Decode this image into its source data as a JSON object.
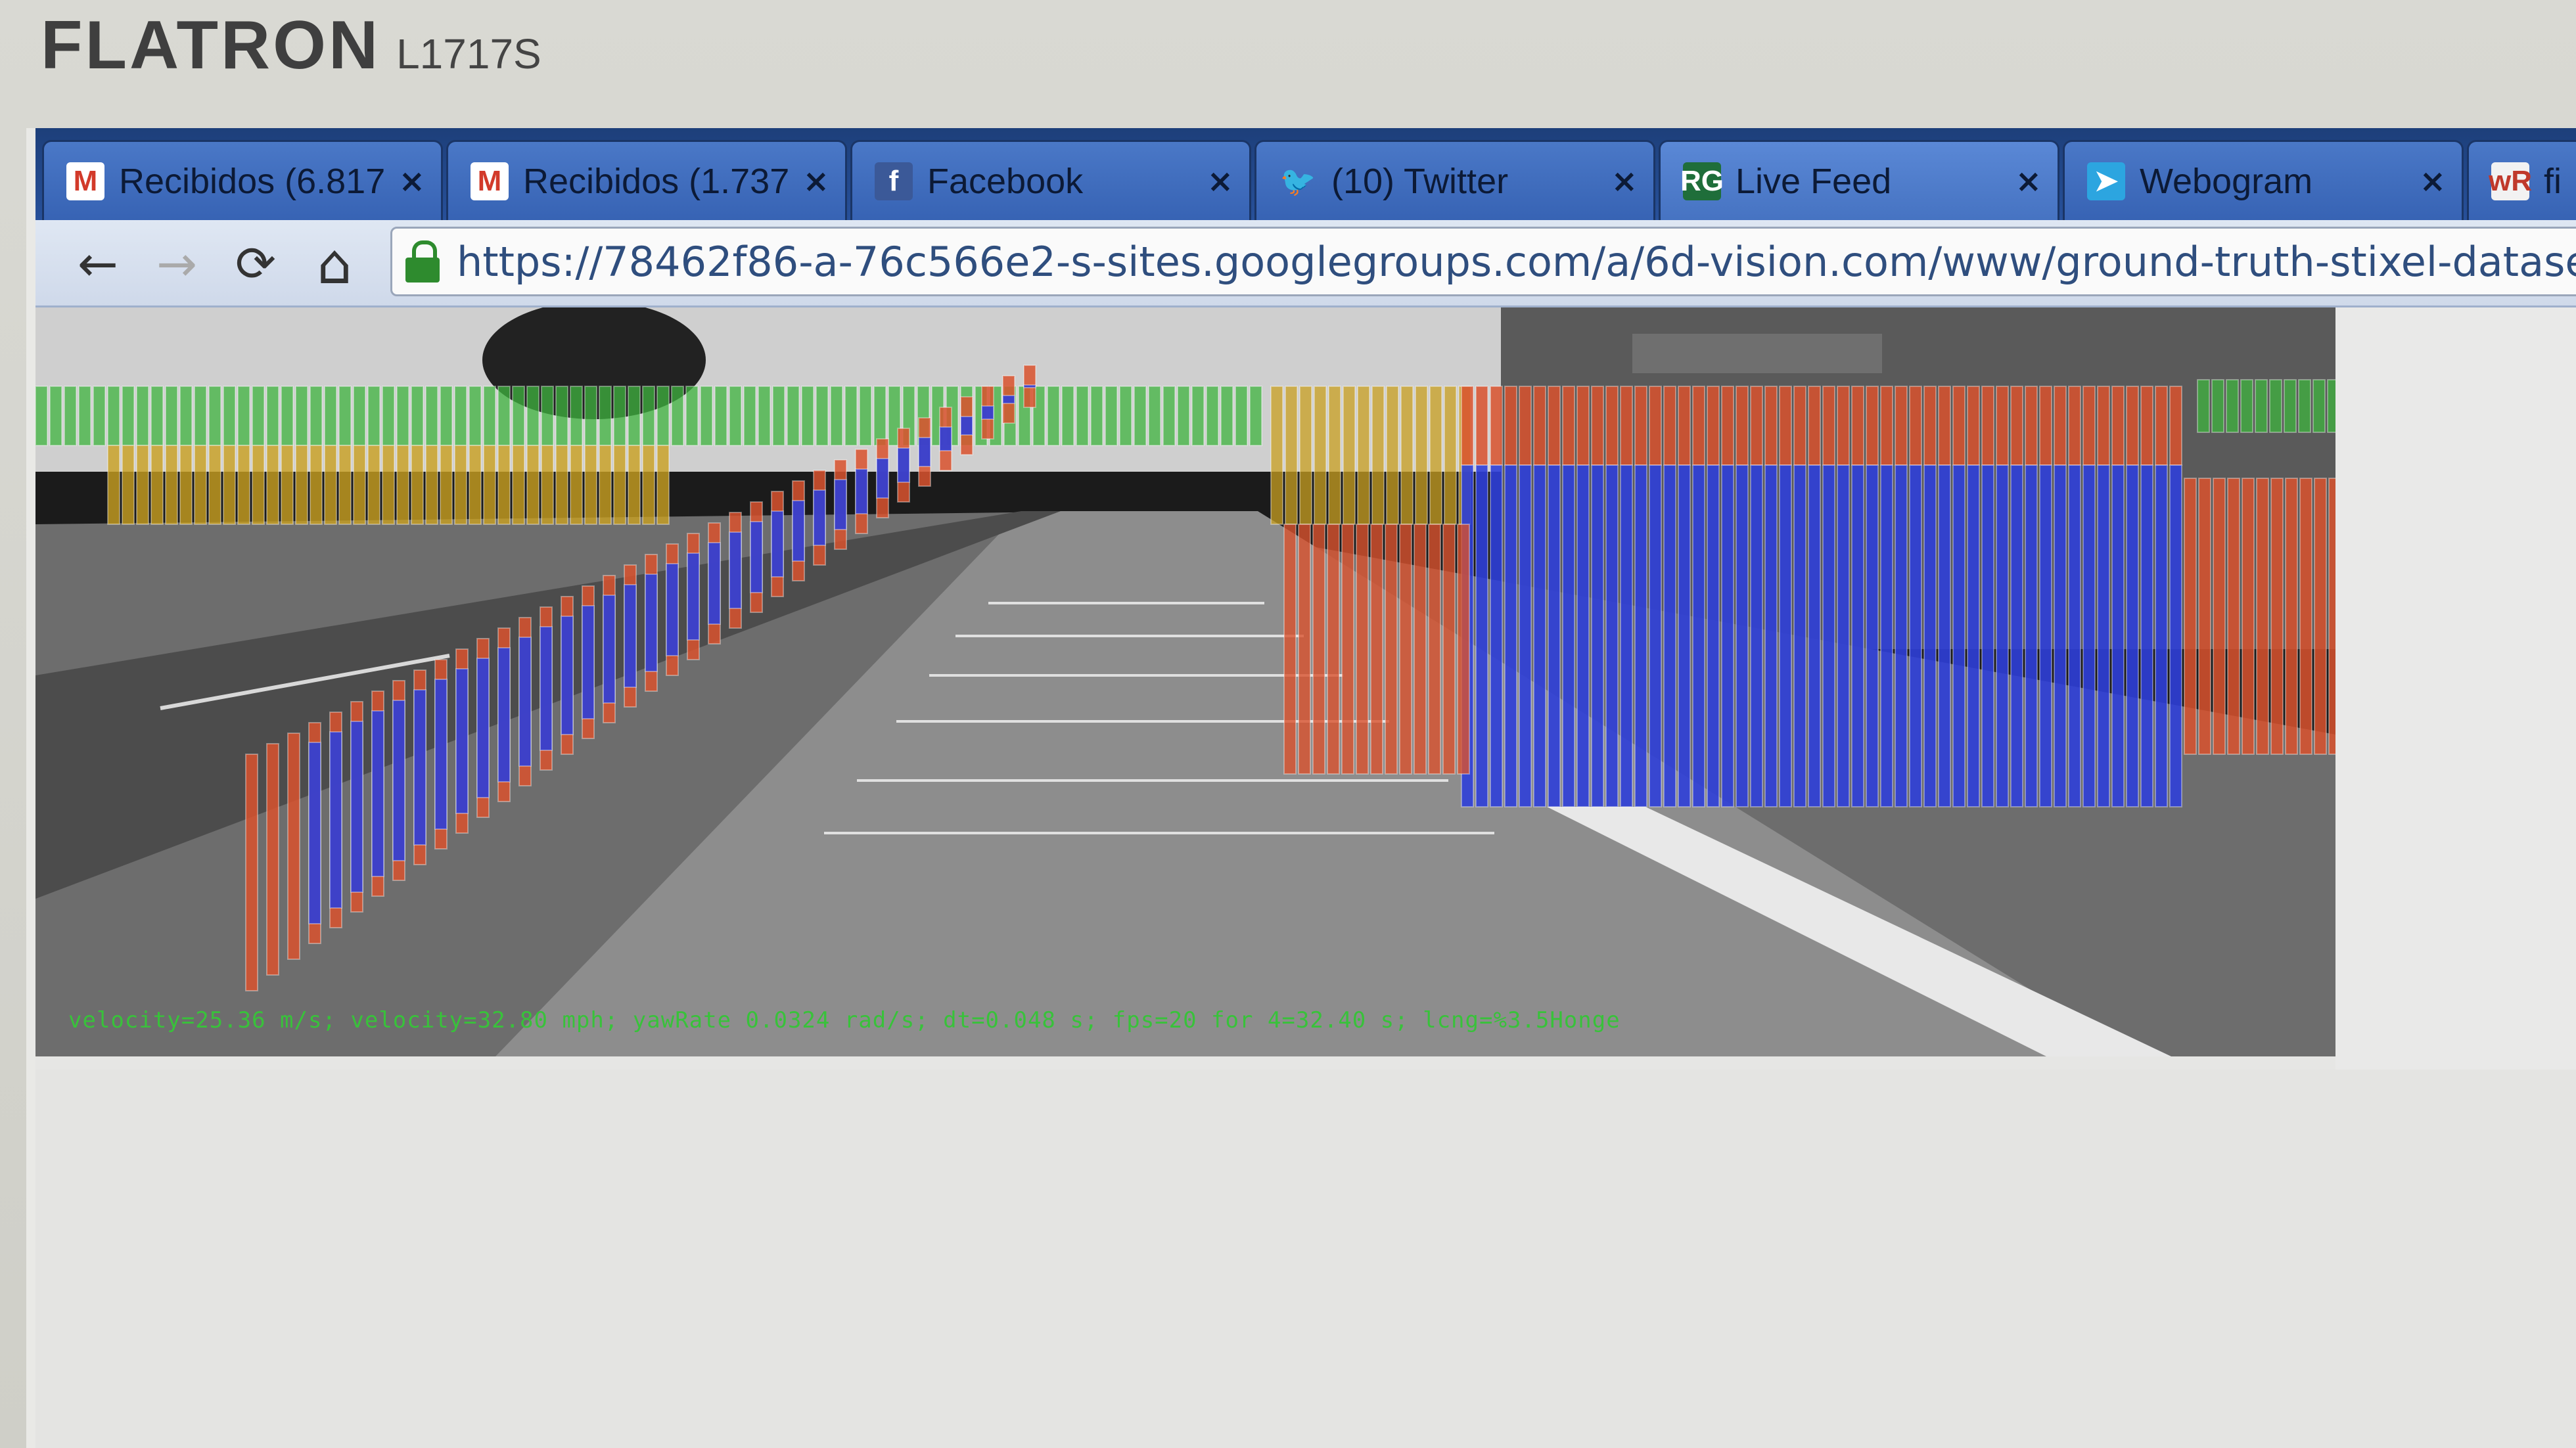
{
  "monitor": {
    "brand": "FLATRON",
    "model": "L1717S"
  },
  "tabs": [
    {
      "label": "Recibidos (6.817",
      "icon": "gmail-icon",
      "icon_glyph": "M",
      "icon_color": "#d23a2a",
      "icon_bg": "#ffffff"
    },
    {
      "label": "Recibidos (1.737",
      "icon": "gmail-icon",
      "icon_glyph": "M",
      "icon_color": "#d23a2a",
      "icon_bg": "#ffffff"
    },
    {
      "label": "Facebook",
      "icon": "facebook-icon",
      "icon_glyph": "f",
      "icon_color": "#ffffff",
      "icon_bg": "#3b5998"
    },
    {
      "label": "(10) Twitter",
      "icon": "twitter-icon",
      "icon_glyph": "🐦",
      "icon_color": "#2aa9e0",
      "icon_bg": "transparent"
    },
    {
      "label": "Live Feed",
      "icon": "researchgate-icon",
      "icon_glyph": "RG",
      "icon_color": "#ffffff",
      "icon_bg": "#1f6e3a"
    },
    {
      "label": "Webogram",
      "icon": "telegram-icon",
      "icon_glyph": "➤",
      "icon_color": "#ffffff",
      "icon_bg": "#2ca5e0"
    },
    {
      "label": "fi",
      "icon": "wordreference-icon",
      "icon_glyph": "wR",
      "icon_color": "#c0392b",
      "icon_bg": "#f2f2f2"
    }
  ],
  "toolbar": {
    "back_icon": "←",
    "forward_icon": "→",
    "reload_icon": "⟳",
    "home_icon": "⌂"
  },
  "address": {
    "url": "https://78462f86-a-76c566e2-s-sites.googlegroups.com/a/6d-vision.com/www/ground-truth-stixel-datase"
  },
  "viewer": {
    "status": "velocity=25.36 m/s; velocity=32.80 mph; yawRate 0.0324 rad/s; dt=0.048 s; fps=20 for 4=32.40 s; lcng=%3.5Honge"
  },
  "colors": {
    "near": "#d9522e",
    "mid": "#c9a021",
    "far": "#3fb43f",
    "core": "#2f3fd8"
  }
}
